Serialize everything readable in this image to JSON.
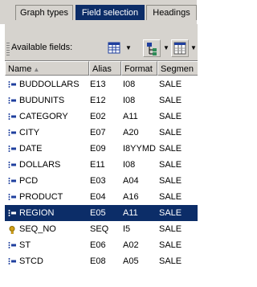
{
  "tabs": [
    {
      "label": "Graph types",
      "active": false
    },
    {
      "label": "Field selection",
      "active": true
    },
    {
      "label": "Headings",
      "active": false
    }
  ],
  "toolbar": {
    "available_label": "Available fields:",
    "icons": [
      "grid-icon",
      "tree-icon",
      "columns-icon"
    ]
  },
  "columns": {
    "name": "Name",
    "alias": "Alias",
    "format": "Format",
    "segment": "Segmen"
  },
  "rows": [
    {
      "name": "BUDDOLLARS",
      "alias": "E13",
      "format": "I08",
      "segment": "SALE",
      "icon": "field-icon"
    },
    {
      "name": "BUDUNITS",
      "alias": "E12",
      "format": "I08",
      "segment": "SALE",
      "icon": "field-icon"
    },
    {
      "name": "CATEGORY",
      "alias": "E02",
      "format": "A11",
      "segment": "SALE",
      "icon": "field-icon"
    },
    {
      "name": "CITY",
      "alias": "E07",
      "format": "A20",
      "segment": "SALE",
      "icon": "field-icon"
    },
    {
      "name": "DATE",
      "alias": "E09",
      "format": "I8YYMD",
      "segment": "SALE",
      "icon": "field-icon"
    },
    {
      "name": "DOLLARS",
      "alias": "E11",
      "format": "I08",
      "segment": "SALE",
      "icon": "field-icon"
    },
    {
      "name": "PCD",
      "alias": "E03",
      "format": "A04",
      "segment": "SALE",
      "icon": "field-icon"
    },
    {
      "name": "PRODUCT",
      "alias": "E04",
      "format": "A16",
      "segment": "SALE",
      "icon": "field-icon"
    },
    {
      "name": "REGION",
      "alias": "E05",
      "format": "A11",
      "segment": "SALE",
      "icon": "field-icon",
      "selected": true
    },
    {
      "name": "SEQ_NO",
      "alias": "SEQ",
      "format": "I5",
      "segment": "SALE",
      "icon": "key-icon"
    },
    {
      "name": "ST",
      "alias": "E06",
      "format": "A02",
      "segment": "SALE",
      "icon": "field-icon"
    },
    {
      "name": "STCD",
      "alias": "E08",
      "format": "A05",
      "segment": "SALE",
      "icon": "field-icon"
    }
  ],
  "colors": {
    "selection": "#0c2d68",
    "chrome": "#d6d3ce",
    "field_icon_blue": "#1f3f9e",
    "key_icon_gold": "#d4a017"
  }
}
